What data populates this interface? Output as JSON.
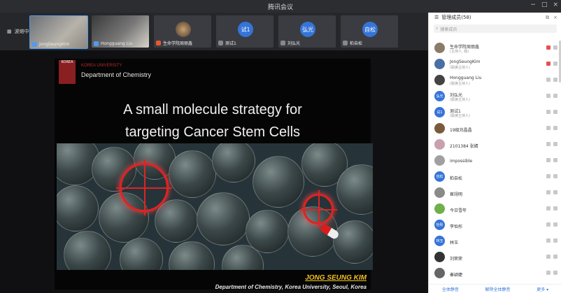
{
  "window": {
    "title": "腾讯会议",
    "min": "−",
    "max": "□",
    "close": "×"
  },
  "strip": {
    "toggle_label": "波缩中"
  },
  "tiles": [
    {
      "name": "JongSeungKim"
    },
    {
      "name": "Hongguang Liu"
    },
    {
      "name": "生命学院周丽鑫"
    },
    {
      "avatar": "试1",
      "name": "测试1"
    },
    {
      "avatar": "弘光",
      "name": "刘弘光"
    },
    {
      "avatar": "自松",
      "name": "柏自松"
    }
  ],
  "slide": {
    "logo_text": "KOREA",
    "university": "KOREA UNIVERSITY",
    "department": "Department of Chemistry",
    "title_line1": "A small molecule strategy for",
    "title_line2": "targeting Cancer Stem Cells",
    "author": "JONG SEUNG KIM",
    "affiliation": "Department of Chemistry, Korea University, Seoul, Korea"
  },
  "panel": {
    "title": "管理成员(58)",
    "search_placeholder": "搜索成员",
    "participants": [
      {
        "name": "生命学院周丽鑫",
        "role": "(主持人, 我)",
        "color": "#8b7b6b",
        "avatar": ""
      },
      {
        "name": "JongSeungKim",
        "role": "(联席主持人)",
        "color": "#4a6fa5",
        "avatar": ""
      },
      {
        "name": "Hongguang Liu",
        "role": "(联席主持人)",
        "color": "#444",
        "avatar": ""
      },
      {
        "name": "刘弘光",
        "role": "(联席主持人)",
        "color": "#3574d8",
        "avatar": "弘光"
      },
      {
        "name": "测试1",
        "role": "(联席主持人)",
        "color": "#3574d8",
        "avatar": "试1"
      },
      {
        "name": "19级刘晶晶",
        "role": "",
        "color": "#7a5a3a",
        "avatar": ""
      },
      {
        "name": "2101384 张婧",
        "role": "",
        "color": "#c8a0b0",
        "avatar": ""
      },
      {
        "name": "impossible",
        "role": "",
        "color": "#a0a0a0",
        "avatar": ""
      },
      {
        "name": "柏自松",
        "role": "",
        "color": "#3574d8",
        "avatar": "自松"
      },
      {
        "name": "崔翊明",
        "role": "",
        "color": "#8a8a8a",
        "avatar": ""
      },
      {
        "name": "今日雪年",
        "role": "",
        "color": "#6fb04a",
        "avatar": ""
      },
      {
        "name": "李怡彤",
        "role": "",
        "color": "#3574d8",
        "avatar": "怡彤"
      },
      {
        "name": "林玉",
        "role": "",
        "color": "#3574d8",
        "avatar": "林玉"
      },
      {
        "name": "刘荣荣",
        "role": "",
        "color": "#333",
        "avatar": ""
      },
      {
        "name": "秦颖婕",
        "role": "",
        "color": "#666",
        "avatar": ""
      }
    ],
    "footer": {
      "mute_all": "全体静音",
      "unmute_all": "解除全体静音",
      "more": "更多 ▾"
    }
  }
}
